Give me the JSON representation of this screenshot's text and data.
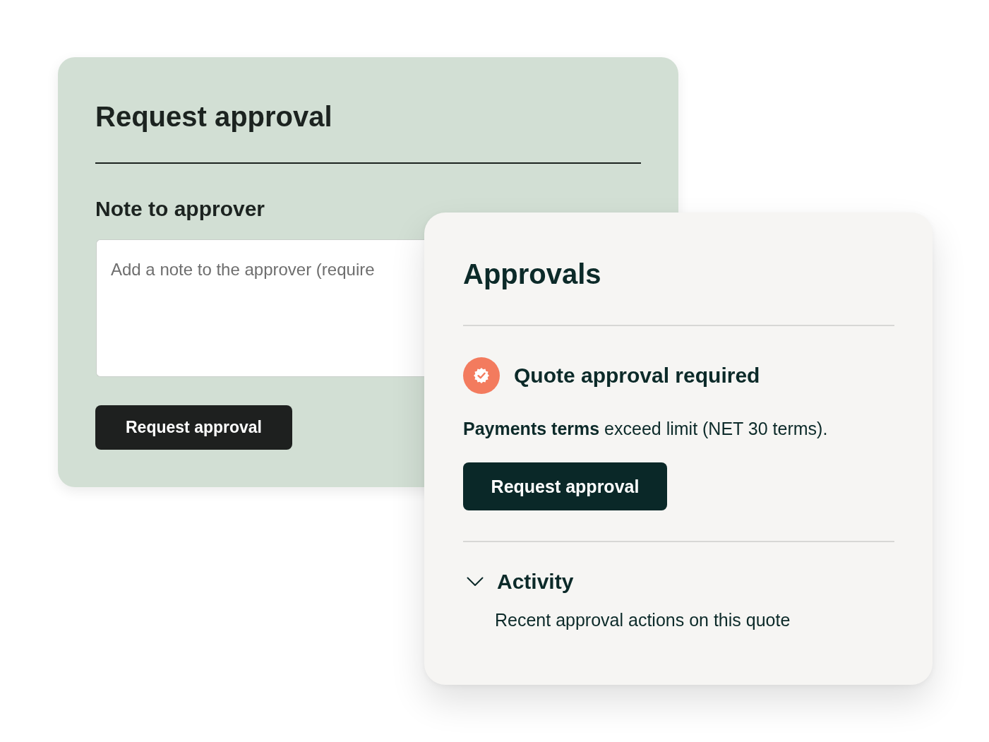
{
  "request_card": {
    "title": "Request approval",
    "note_label": "Note to approver",
    "note_field": {
      "placeholder": "Add a note to the approver (require"
    },
    "button": "Request approval"
  },
  "approvals_card": {
    "title": "Approvals",
    "alert": {
      "title": "Quote approval required",
      "message": "**Payments terms** exceed limit (NET 30 terms).",
      "button": "Request approval"
    },
    "activity": {
      "title": "Activity",
      "expanded": true,
      "subtitle": "Recent approval actions on this quote"
    }
  }
}
